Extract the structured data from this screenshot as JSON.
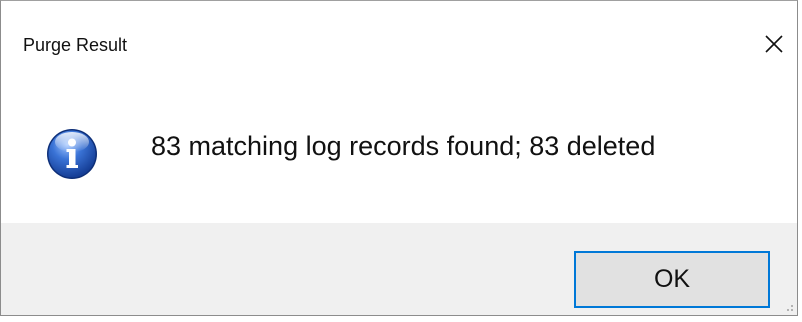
{
  "window": {
    "title": "Purge Result",
    "close_icon": "close-icon"
  },
  "content": {
    "icon": "info-icon",
    "message": "83 matching log records found; 83 deleted"
  },
  "footer": {
    "ok_label": "OK"
  },
  "colors": {
    "accent": "#0078d7",
    "footer_bg": "#f0f0f0",
    "button_bg": "#e1e1e1",
    "icon_blue": "#1c4fb0"
  }
}
